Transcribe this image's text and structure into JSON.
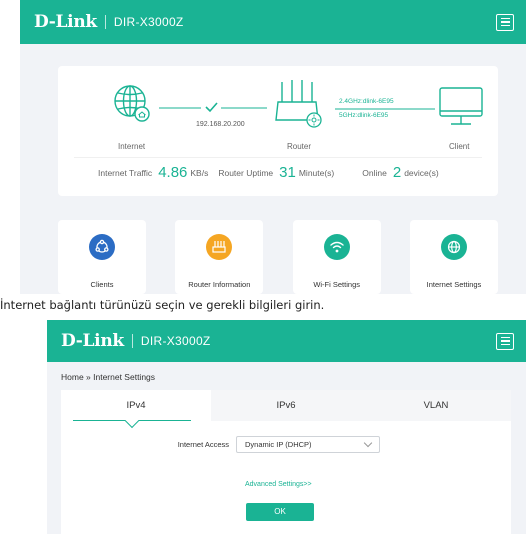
{
  "brand": {
    "name": "D-Link",
    "model": "DIR-X3000Z"
  },
  "colors": {
    "accent": "#1ab394",
    "clients": "#2b6cc4",
    "router_info": "#f5a623",
    "wifi": "#1ab394",
    "internet_settings": "#1ab394"
  },
  "dashboard": {
    "ip_address": "192.168.20.200",
    "ssid_24": "2.4GHz:dlink-6E95",
    "ssid_5": "5GHz:dlink-6E95",
    "node_labels": {
      "internet": "Internet",
      "router": "Router",
      "client": "Client"
    },
    "stats": {
      "traffic_label": "Internet Traffic",
      "traffic_value": "4.86",
      "traffic_unit": "KB/s",
      "uptime_label": "Router Uptime",
      "uptime_value": "31",
      "uptime_unit": "Minute(s)",
      "online_label": "Online",
      "online_value": "2",
      "online_unit": "device(s)"
    },
    "tiles": [
      {
        "label": "Clients",
        "icon": "clients-icon"
      },
      {
        "label": "Router Information",
        "icon": "router-info-icon"
      },
      {
        "label": "Wi-Fi Settings",
        "icon": "wifi-icon"
      },
      {
        "label": "Internet Settings",
        "icon": "globe-settings-icon"
      }
    ]
  },
  "caption": "İnternet bağlantı türünüzü seçin ve gerekli bilgileri girin.",
  "settings": {
    "breadcrumb": "Home  »  Internet Settings",
    "tabs": [
      "IPv4",
      "IPv6",
      "VLAN"
    ],
    "internet_access_label": "Internet Access",
    "internet_access_value": "Dynamic IP (DHCP)",
    "advanced_link": "Advanced Settings>>",
    "ok_label": "OK"
  }
}
